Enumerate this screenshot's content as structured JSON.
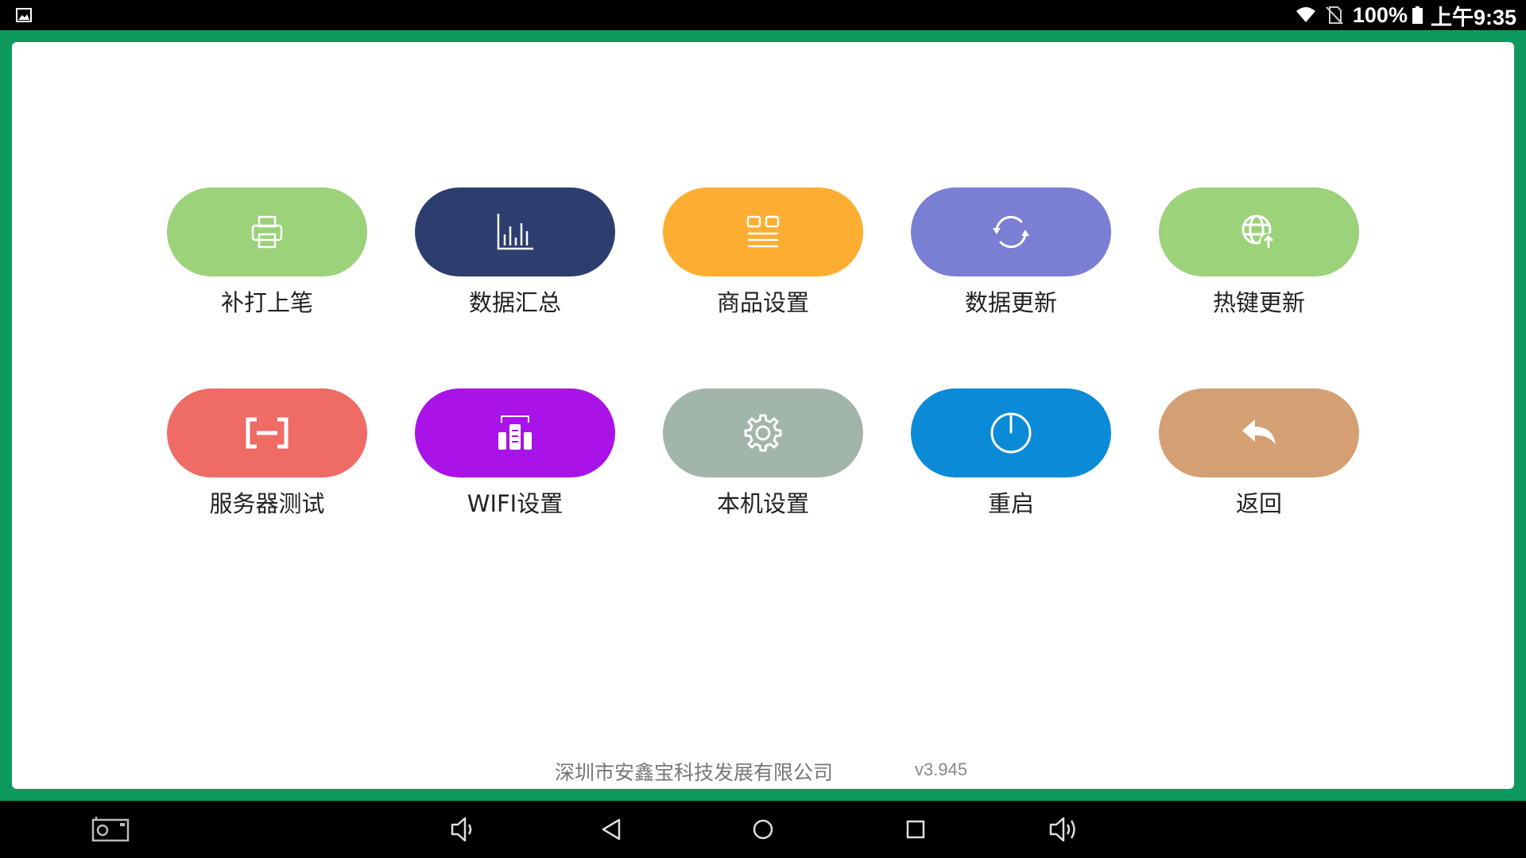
{
  "status_bar": {
    "battery_text": "100%",
    "time": "上午9:35",
    "icons": [
      "image-notification-icon",
      "wifi-icon",
      "no-sim-icon",
      "battery-icon"
    ]
  },
  "menu": {
    "row1": [
      {
        "label": "补打上笔",
        "icon": "printer-icon",
        "color": "#9bd27a"
      },
      {
        "label": "数据汇总",
        "icon": "bar-chart-icon",
        "color": "#2c3e6e"
      },
      {
        "label": "商品设置",
        "icon": "product-grid-icon",
        "color": "#fdae32"
      },
      {
        "label": "数据更新",
        "icon": "sync-icon",
        "color": "#7b7fd3"
      },
      {
        "label": "热键更新",
        "icon": "globe-upload-icon",
        "color": "#9bd27a"
      }
    ],
    "row2": [
      {
        "label": "服务器测试",
        "icon": "server-link-icon",
        "color": "#ef6b66"
      },
      {
        "label": "WIFI设置",
        "icon": "wifi-settings-icon",
        "color": "#a913e8"
      },
      {
        "label": "本机设置",
        "icon": "gear-icon",
        "color": "#a1b5a8"
      },
      {
        "label": "重启",
        "icon": "power-icon",
        "color": "#0b8ad8"
      },
      {
        "label": "返回",
        "icon": "reply-back-icon",
        "color": "#d4a073"
      }
    ]
  },
  "footer": {
    "company": "深圳市安鑫宝科技发展有限公司",
    "version": "v3.945"
  },
  "nav_bar": {
    "buttons": [
      "screenshot-icon",
      "volume-down-icon",
      "back-icon",
      "home-icon",
      "recents-icon",
      "volume-up-icon"
    ]
  },
  "colors": {
    "frame_green": "#0e9a5e",
    "panel_white": "#ffffff"
  }
}
